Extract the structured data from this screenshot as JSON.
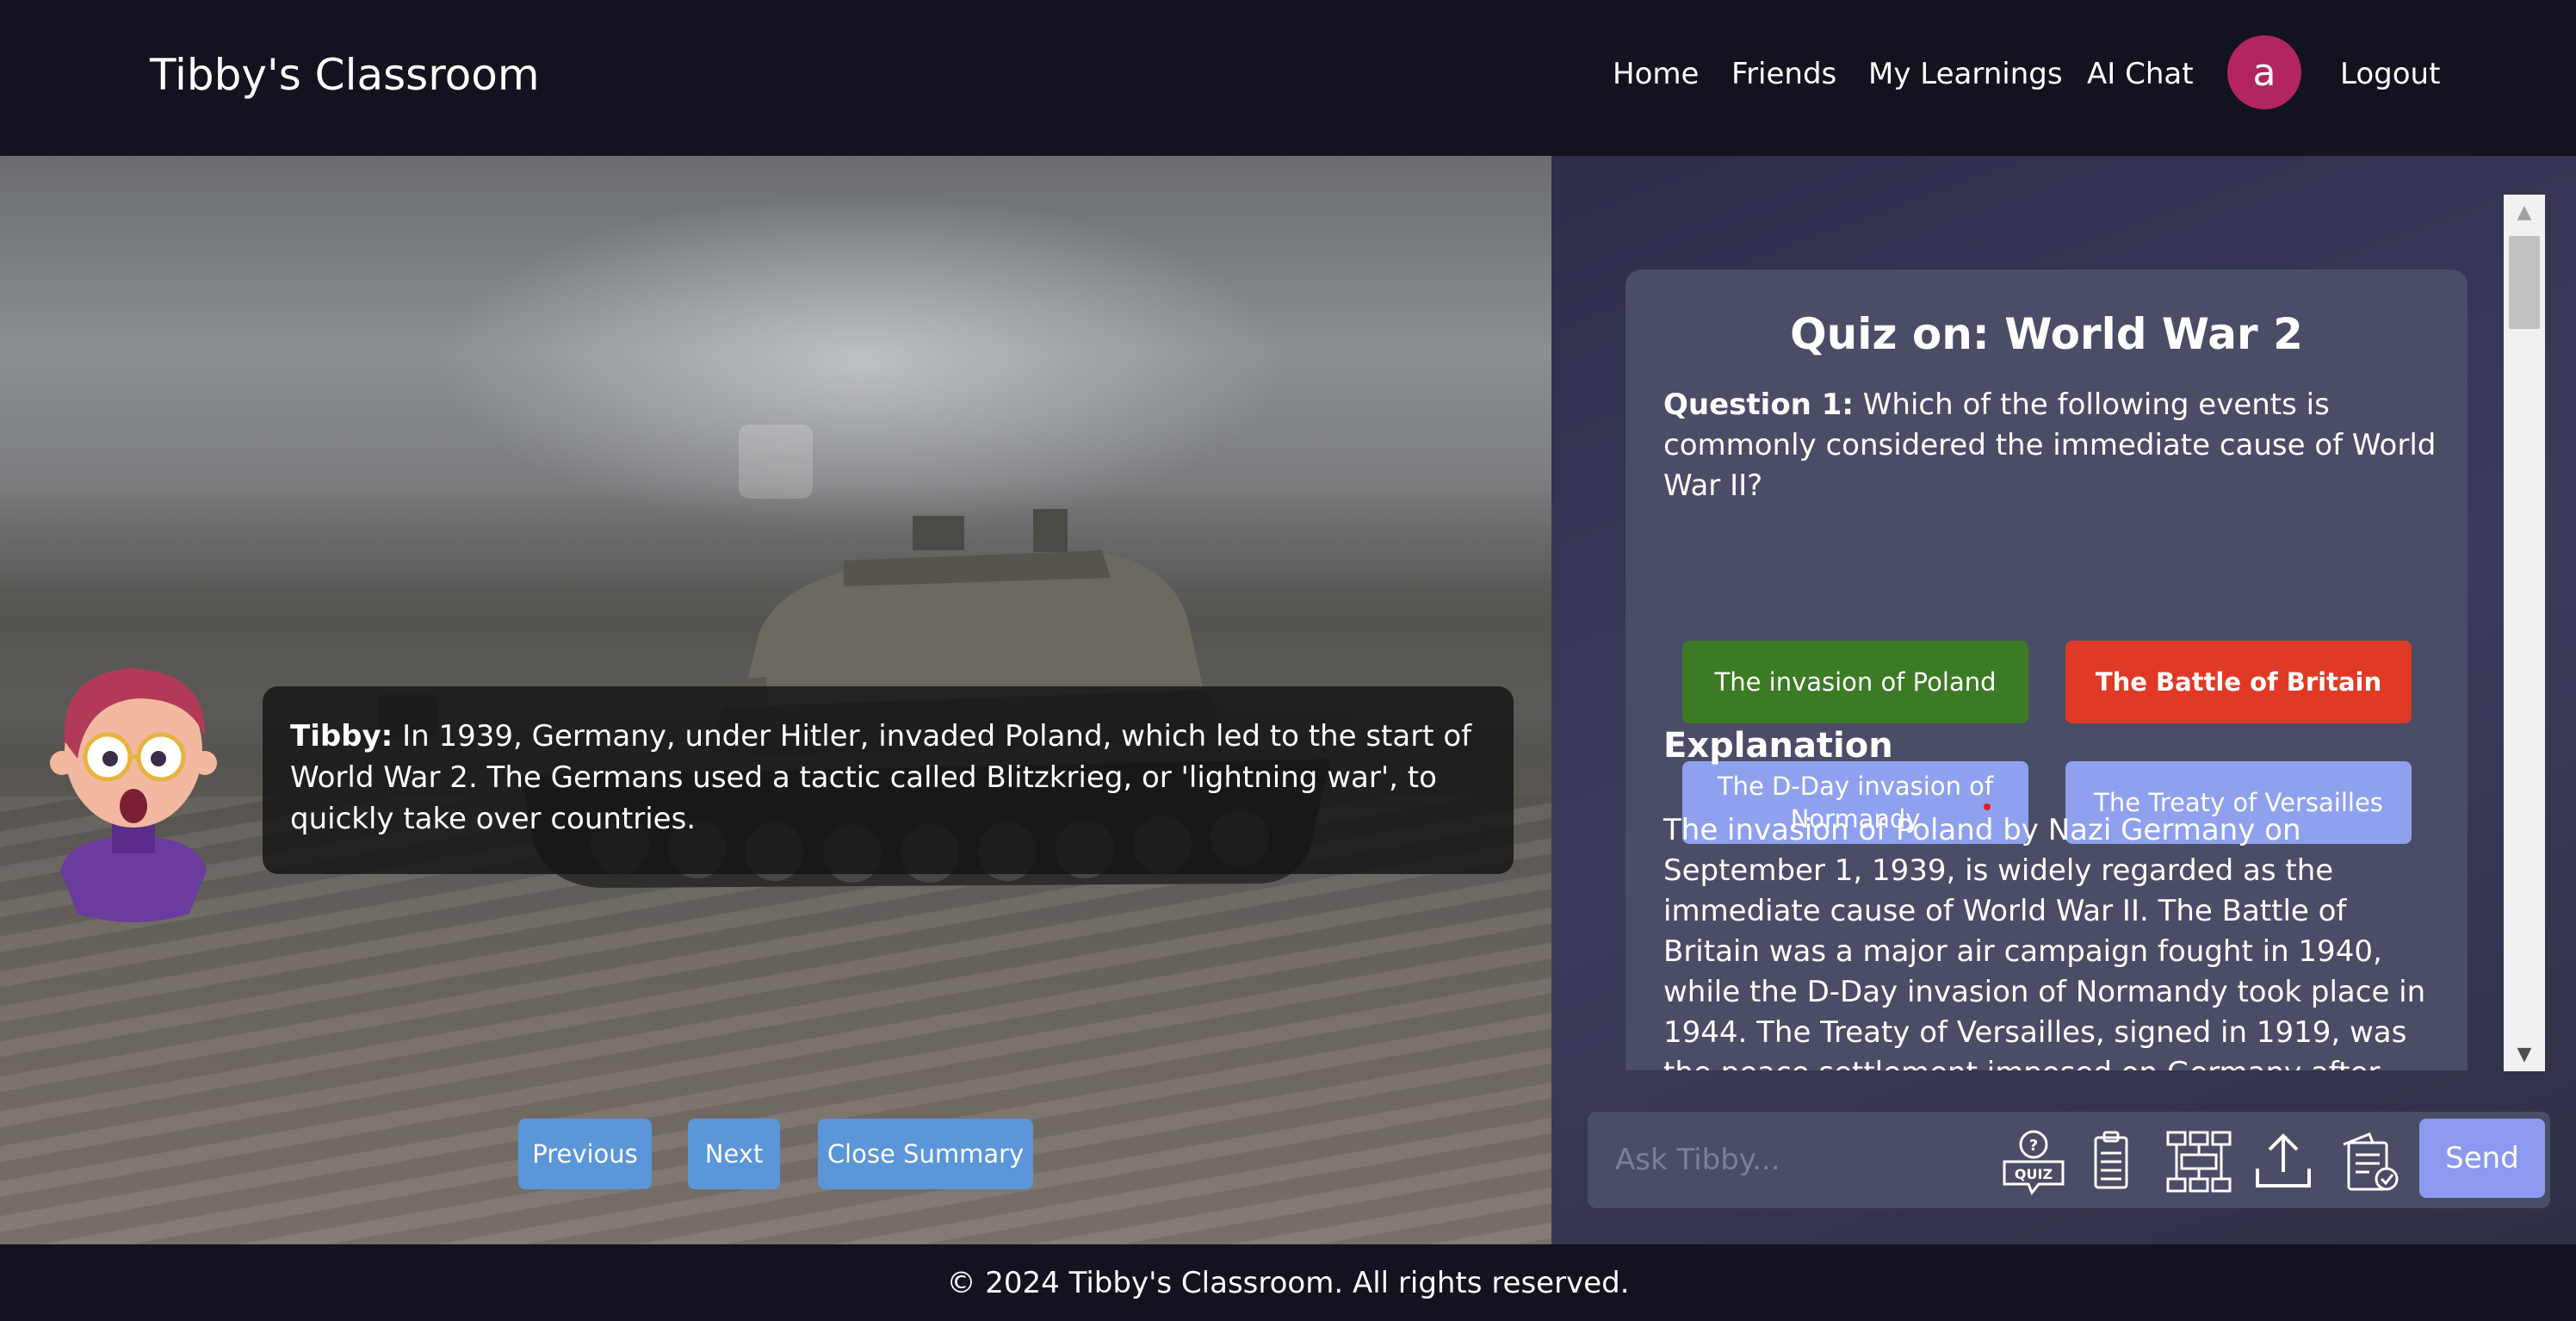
{
  "header": {
    "brand": "Tibby's Classroom",
    "nav": {
      "home": "Home",
      "friends": "Friends",
      "my_learnings": "My Learnings",
      "ai_chat": "AI Chat",
      "logout": "Logout"
    },
    "avatar_letter": "a"
  },
  "scene": {
    "speaker": "Tibby:",
    "narration": " In 1939, Germany, under Hitler, invaded Poland, which led to the start of World War 2. The Germans used a tactic called Blitzkrieg, or 'lightning war', to quickly take over countries.",
    "buttons": {
      "previous": "Previous",
      "next": "Next",
      "close_summary": "Close Summary"
    }
  },
  "quiz": {
    "title": "Quiz on: World War 2",
    "question_label": "Question 1:",
    "question_text": " Which of the following events is commonly considered the immediate cause of World War II?",
    "options": [
      {
        "label": "The invasion of Poland",
        "state": "correct"
      },
      {
        "label": "The Battle of Britain",
        "state": "wrong"
      },
      {
        "label": "The D-Day invasion of Normandy",
        "state": "neutral"
      },
      {
        "label": "The Treaty of Versailles",
        "state": "neutral"
      }
    ],
    "explanation_title": "Explanation",
    "explanation_text": "The invasion of Poland by Nazi Germany on September 1, 1939, is widely regarded as the immediate cause of World War II. The Battle of Britain was a major air campaign fought in 1940, while the D-Day invasion of Normandy took place in 1944. The Treaty of Versailles, signed in 1919, was the peace settlement imposed on Germany after World War I and is seen as a contributing"
  },
  "chat": {
    "placeholder": "Ask Tibby...",
    "quiz_icon_text": "QUIZ",
    "send": "Send",
    "tools": [
      "quiz-icon",
      "clipboard-icon",
      "mindmap-icon",
      "upload-icon",
      "document-check-icon"
    ]
  },
  "footer": {
    "copyright": "© 2024 Tibby's Classroom. All rights reserved."
  },
  "colors": {
    "background": "#12131f",
    "panel": "#2c2e4a",
    "card": "#4a4d66",
    "correct": "#3d7a25",
    "wrong": "#e03a26",
    "option": "#8fa1ee",
    "scene_button": "#5a96d8",
    "send": "#8b9af0",
    "avatar": "#b3255f"
  }
}
